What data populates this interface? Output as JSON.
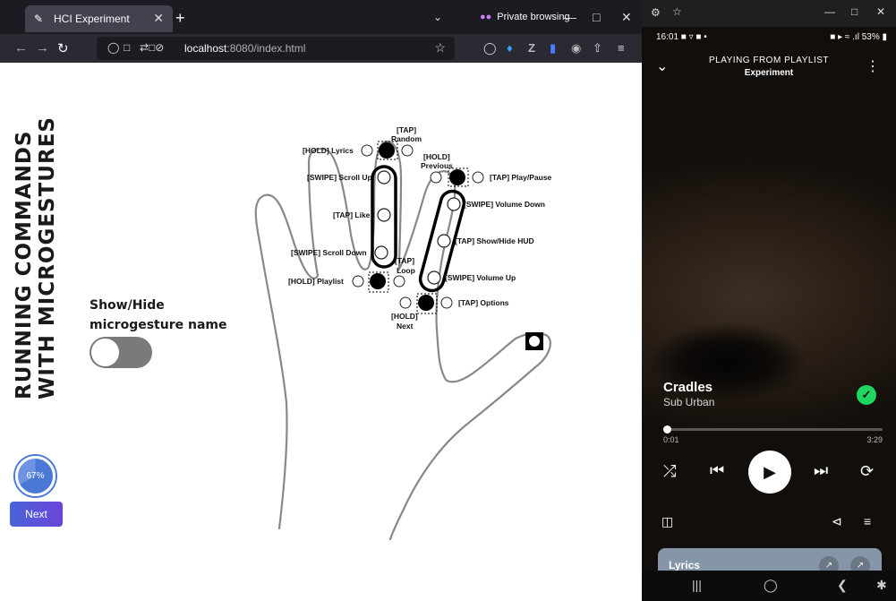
{
  "browser": {
    "tab_title": "HCI Experiment",
    "private_label": "Private browsing",
    "url_host": "localhost",
    "url_rest": ":8080/index.html"
  },
  "page": {
    "side_title_line1": "RUNNING COMMANDS",
    "side_title_line2": "WITH MICROGESTURES",
    "toggle_label_line1": "Show/Hide",
    "toggle_label_line2": "microgesture name",
    "toggle_on": false,
    "progress_text": "67%",
    "progress_value": 0.67,
    "next_label": "Next"
  },
  "gestures": {
    "lyrics": "[HOLD] Lyrics",
    "random_1": "[TAP]",
    "random_2": "Random",
    "previous_1": "[HOLD]",
    "previous_2": "Previous",
    "play_pause": "[TAP] Play/Pause",
    "scroll_up": "[SWIPE] Scroll Up",
    "like": "[TAP] Like",
    "volume_down": "[SWIPE] Volume Down",
    "show_hide_hud": "[TAP] Show/Hide HUD",
    "scroll_down": "[SWIPE] Scroll Down",
    "loop_1": "[TAP]",
    "loop_2": "Loop",
    "volume_up": "[SWIPE] Volume Up",
    "playlist": "[HOLD] Playlist",
    "options": "[TAP] Options",
    "next_1": "[HOLD]",
    "next_2": "Next"
  },
  "phone": {
    "time": "16:01",
    "battery": "53%",
    "playing_from": "PLAYING FROM PLAYLIST",
    "playlist_name": "Experiment",
    "song_title": "Cradles",
    "artist": "Sub Urban",
    "elapsed": "0:01",
    "total": "3:29",
    "progress": 0.005,
    "lyrics_label": "Lyrics"
  },
  "colors": {
    "accent_green": "#1ed760",
    "progress_blue": "#4a78d6",
    "next_gradient_start": "#4a64d8",
    "next_gradient_end": "#6a44d8"
  }
}
